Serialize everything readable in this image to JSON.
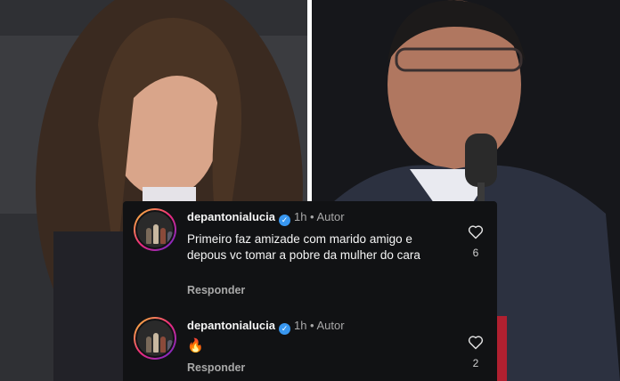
{
  "comments": [
    {
      "username": "depantonialucia",
      "time": "1h",
      "author_tag": "Autor",
      "text": "Primeiro faz amizade com marido amigo e depous vc tomar a pobre da mulher do cara",
      "reply_label": "Responder",
      "likes": "6"
    },
    {
      "username": "depantonialucia",
      "time": "1h",
      "author_tag": "Autor",
      "text": "🔥",
      "reply_label": "Responder",
      "likes": "2"
    }
  ],
  "icons": {
    "verified": "verified-badge-icon",
    "like": "heart-icon"
  },
  "colors": {
    "card_bg": "#111214",
    "verified_blue": "#3897f0",
    "muted_text": "#a8a8a8"
  }
}
